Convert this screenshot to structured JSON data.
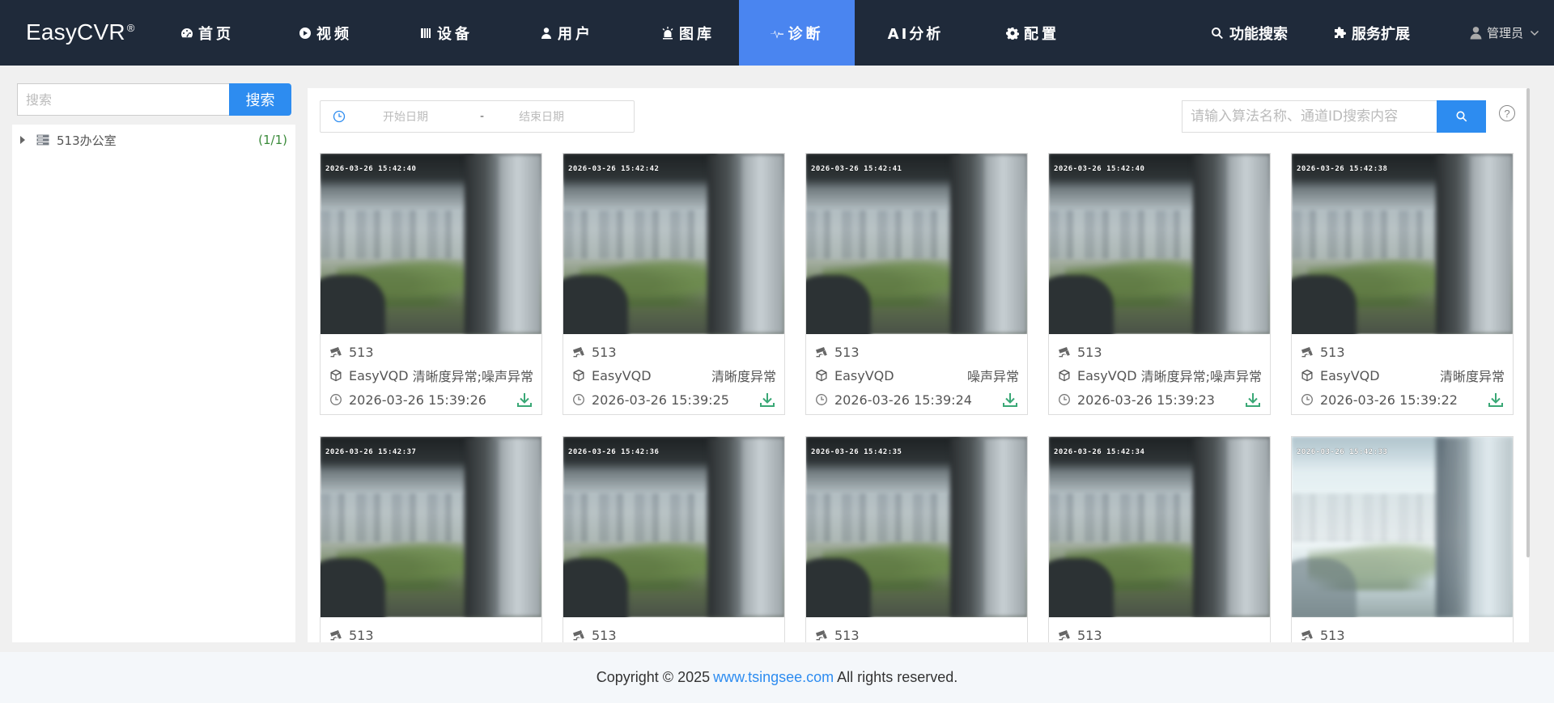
{
  "brand": {
    "name": "EasyCVR",
    "reg": "®"
  },
  "nav": {
    "items": [
      {
        "label": "首页",
        "icon": "dashboard-icon"
      },
      {
        "label": "视频",
        "icon": "play-icon"
      },
      {
        "label": "设备",
        "icon": "device-icon"
      },
      {
        "label": "用户",
        "icon": "user-icon"
      },
      {
        "label": "图库",
        "icon": "alarm-icon"
      },
      {
        "label": "诊断",
        "icon": "pulse-icon",
        "active": true
      },
      {
        "label": "AI分析",
        "icon": ""
      },
      {
        "label": "配置",
        "icon": "gear-icon"
      }
    ],
    "feature_search": "功能搜索",
    "service_ext": "服务扩展",
    "user": "管理员"
  },
  "sidebar": {
    "search_placeholder": "搜索",
    "search_button": "搜索",
    "tree": [
      {
        "label": "513办公室",
        "count": "(1/1)"
      }
    ]
  },
  "toolbar": {
    "start_date": "开始日期",
    "separator": "-",
    "end_date": "结束日期",
    "search_placeholder": "请输入算法名称、通道ID搜索内容",
    "help": "?"
  },
  "cards": [
    {
      "timestamp_overlay": "2026-03-26  15:42:40",
      "channel": "513",
      "algo": "EasyVQD",
      "result": "清晰度异常;噪声异常",
      "time": "2026-03-26 15:39:26",
      "bright": false
    },
    {
      "timestamp_overlay": "2026-03-26  15:42:42",
      "channel": "513",
      "algo": "EasyVQD",
      "result": "清晰度异常",
      "time": "2026-03-26 15:39:25",
      "bright": false
    },
    {
      "timestamp_overlay": "2026-03-26  15:42:41",
      "channel": "513",
      "algo": "EasyVQD",
      "result": "噪声异常",
      "time": "2026-03-26 15:39:24",
      "bright": false
    },
    {
      "timestamp_overlay": "2026-03-26  15:42:40",
      "channel": "513",
      "algo": "EasyVQD",
      "result": "清晰度异常;噪声异常",
      "time": "2026-03-26 15:39:23",
      "bright": false
    },
    {
      "timestamp_overlay": "2026-03-26  15:42:38",
      "channel": "513",
      "algo": "EasyVQD",
      "result": "清晰度异常",
      "time": "2026-03-26 15:39:22",
      "bright": false
    },
    {
      "timestamp_overlay": "2026-03-26  15:42:37",
      "channel": "513",
      "bright": false
    },
    {
      "timestamp_overlay": "2026-03-26  15:42:36",
      "channel": "513",
      "bright": false
    },
    {
      "timestamp_overlay": "2026-03-26  15:42:35",
      "channel": "513",
      "bright": false
    },
    {
      "timestamp_overlay": "2026-03-26  15:42:34",
      "channel": "513",
      "bright": false
    },
    {
      "timestamp_overlay": "2026-03-26  15:42:33",
      "channel": "513",
      "bright": true
    }
  ],
  "footer": {
    "prefix": "Copyright © 2025",
    "link": "www.tsingsee.com",
    "suffix": "All rights reserved."
  },
  "colors": {
    "nav_bg": "#1f2a3a",
    "accent": "#2d8cf0",
    "nav_active": "#4a85f0",
    "download_green": "#3aa876"
  }
}
